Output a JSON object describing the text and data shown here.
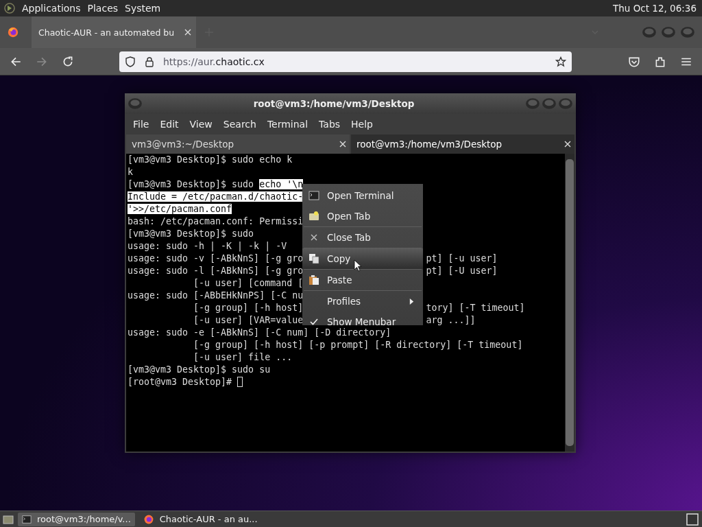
{
  "top_panel": {
    "menus": [
      "Applications",
      "Places",
      "System"
    ],
    "clock": "Thu Oct 12, 06:36"
  },
  "browser": {
    "tabs": [
      {
        "title": "Chaotic-AUR - an automated bu",
        "selected": true
      }
    ],
    "url": {
      "prefix": "https://aur.",
      "domain": "chaotic.cx"
    },
    "nav": {
      "back_disabled": false,
      "forward_disabled": true
    }
  },
  "terminal": {
    "title": "root@vm3:/home/vm3/Desktop",
    "menu": [
      "File",
      "Edit",
      "View",
      "Search",
      "Terminal",
      "Tabs",
      "Help"
    ],
    "tabs": [
      {
        "title": "vm3@vm3:~/Desktop",
        "selected": false
      },
      {
        "title": "root@vm3:/home/vm3/Desktop",
        "selected": true
      }
    ],
    "lines": [
      {
        "segments": [
          {
            "text": "[vm3@vm3 Desktop]$ sudo echo k",
            "selected": false
          }
        ]
      },
      {
        "segments": [
          {
            "text": "k",
            "selected": false
          }
        ]
      },
      {
        "segments": [
          {
            "text": "[vm3@vm3 Desktop]$ sudo ",
            "selected": false
          },
          {
            "text": "echo '\\n",
            "selected": true
          }
        ]
      },
      {
        "segments": [
          {
            "text": "Include = /etc/pacman.d/chaotic-",
            "selected": true
          }
        ]
      },
      {
        "segments": [
          {
            "text": "'>>/etc/pacman.conf",
            "selected": true
          }
        ]
      },
      {
        "segments": [
          {
            "text": "bash: /etc/pacman.conf: Permissi",
            "selected": false
          }
        ]
      },
      {
        "segments": [
          {
            "text": "[vm3@vm3 Desktop]$ sudo",
            "selected": false
          }
        ]
      },
      {
        "segments": [
          {
            "text": "usage: sudo -h | -K | -k | -V",
            "selected": false
          }
        ]
      },
      {
        "segments": [
          {
            "text": "usage: sudo -v [-ABkNnS] [-g gro",
            "selected": false
          }
        ],
        "tail": "pt] [-u user]"
      },
      {
        "segments": [
          {
            "text": "usage: sudo -l [-ABkNnS] [-g gro",
            "selected": false
          }
        ],
        "tail": "pt] [-U user]"
      },
      {
        "segments": [
          {
            "text": "            [-u user] [command [",
            "selected": false
          }
        ]
      },
      {
        "segments": [
          {
            "text": "usage: sudo [-ABbEHkNnPS] [-C nu",
            "selected": false
          }
        ]
      },
      {
        "segments": [
          {
            "text": "            [-g group] [-h host]",
            "selected": false
          }
        ],
        "tail": "tory] [-T timeout]"
      },
      {
        "segments": [
          {
            "text": "            [-u user] [VAR=value",
            "selected": false
          }
        ],
        "tail": "arg ...]]"
      },
      {
        "segments": [
          {
            "text": "usage: sudo -e [-ABkNnS] [-C num] [-D directory]",
            "selected": false
          }
        ]
      },
      {
        "segments": [
          {
            "text": "            [-g group] [-h host] [-p prompt] [-R directory] [-T timeout]",
            "selected": false
          }
        ]
      },
      {
        "segments": [
          {
            "text": "            [-u user] file ...",
            "selected": false
          }
        ]
      },
      {
        "segments": [
          {
            "text": "[vm3@vm3 Desktop]$ sudo su",
            "selected": false
          }
        ]
      },
      {
        "segments": [
          {
            "text": "[root@vm3 Desktop]# ",
            "selected": false
          }
        ],
        "cursor": true
      }
    ]
  },
  "context_menu": [
    {
      "label": "Open Terminal",
      "kind": "terminal",
      "selected": false
    },
    {
      "label": "Open Tab",
      "kind": "tab",
      "selected": false
    },
    {
      "label": "Close Tab",
      "kind": "close",
      "selected": false
    },
    {
      "label": "Copy",
      "kind": "copy",
      "selected": true
    },
    {
      "label": "Paste",
      "kind": "paste",
      "selected": false
    },
    {
      "label": "Profiles",
      "kind": "submenu",
      "selected": false
    },
    {
      "label": "Show Menubar",
      "kind": "check",
      "selected": false
    }
  ],
  "taskbar": [
    {
      "title": "root@vm3:/home/v...",
      "kind": "terminal",
      "selected": true
    },
    {
      "title": "Chaotic-AUR - an au...",
      "kind": "browser",
      "selected": false
    }
  ]
}
